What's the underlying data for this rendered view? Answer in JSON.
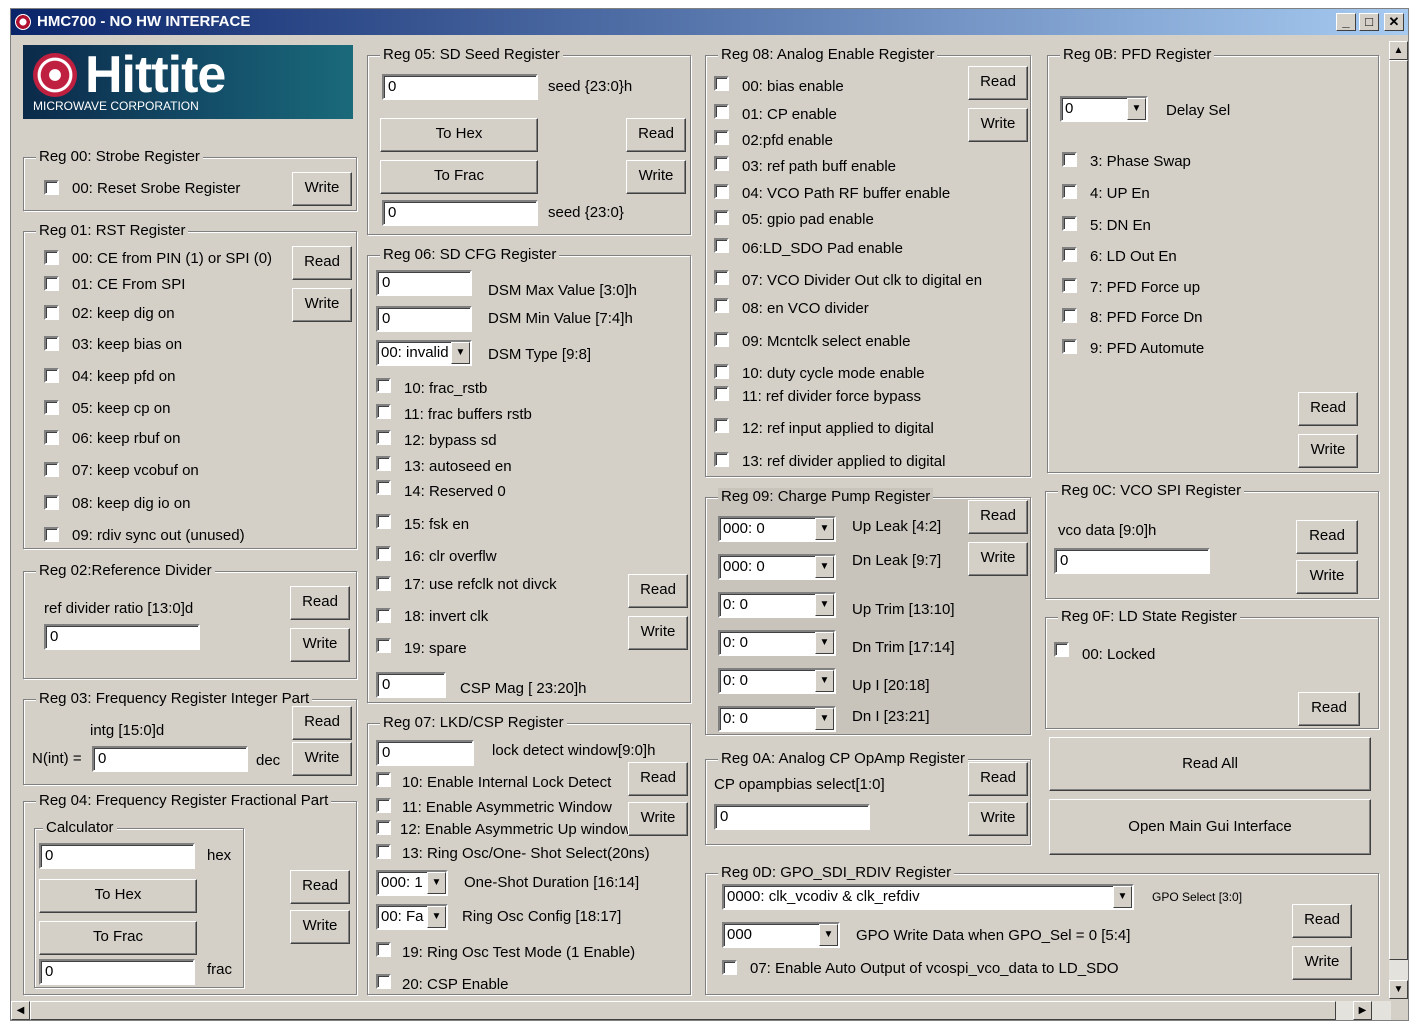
{
  "window": {
    "title": "HMC700 - NO HW INTERFACE"
  },
  "logo": {
    "name": "Hittite",
    "sub": "MICROWAVE CORPORATION"
  },
  "buttons": {
    "read": "Read",
    "write": "Write",
    "to_hex": "To Hex",
    "to_frac": "To Frac",
    "read_all": "Read All",
    "open_main": "Open Main Gui  Interface"
  },
  "reg00": {
    "title": "Reg 00: Strobe Register",
    "items": [
      "00: Reset Srobe Register"
    ]
  },
  "reg01": {
    "title": "Reg 01: RST Register",
    "items": [
      "00: CE from PIN (1) or SPI (0)",
      "01: CE From SPI",
      "02: keep dig on",
      "03: keep bias on",
      "04: keep pfd on",
      "05: keep cp on",
      "06: keep rbuf on",
      "07: keep vcobuf on",
      "08: keep dig io on",
      "09: rdiv sync out (unused)"
    ]
  },
  "reg02": {
    "title": "Reg 02:Reference Divider",
    "label": "ref divider ratio [13:0]d",
    "value": "0"
  },
  "reg03": {
    "title": "Reg 03: Frequency Register  Integer Part",
    "label": "intg [15:0]d",
    "nint": "N(int) =",
    "value": "0",
    "unit": "dec"
  },
  "reg04": {
    "title": "Reg 04: Frequency Register Fractional Part",
    "calc": "Calculator",
    "hex_value": "0",
    "hex_label": "hex",
    "frac_value": "0",
    "frac_label": "frac"
  },
  "reg05": {
    "title": "Reg 05: SD Seed Register",
    "seed_hex": "0",
    "seed_hex_label": "seed {23:0}h",
    "seed": "0",
    "seed_label": "seed {23:0}"
  },
  "reg06": {
    "title": "Reg 06: SD CFG Register",
    "max_value": "0",
    "max_label": "DSM Max Value [3:0]h",
    "min_value": "0",
    "min_label": "DSM Min Value [7:4]h",
    "type_value": "00: invalid",
    "type_label": "DSM Type [9:8]",
    "items": [
      "10: frac_rstb",
      "11: frac buffers rstb",
      "12: bypass sd",
      "13: autoseed en",
      "14: Reserved 0",
      "15: fsk en",
      "16: clr overflw",
      "17: use refclk not divck",
      "18: invert clk",
      "19: spare"
    ],
    "csp_value": "0",
    "csp_label": "CSP Mag [ 23:20]h"
  },
  "reg07": {
    "title": "Reg 07: LKD/CSP Register",
    "lock_value": "0",
    "lock_label": "lock detect window[9:0]h",
    "items": [
      "10: Enable Internal Lock Detect",
      "11: Enable Asymmetric Window",
      "12: Enable Asymmetric Up window",
      "13: Ring Osc/One- Shot Select(20ns)"
    ],
    "oneshot_value": "000: 1",
    "oneshot_label": "One-Shot  Duration [16:14]",
    "ring_value": "00: Fa",
    "ring_label": "Ring Osc Config [18:17]",
    "items2": [
      "19:  Ring Osc Test Mode (1 Enable)",
      "20: CSP Enable"
    ]
  },
  "reg08": {
    "title": "Reg 08: Analog Enable Register",
    "items": [
      "00: bias enable",
      "01: CP enable",
      "02:pfd enable",
      "03: ref path  buff enable",
      "04: VCO Path RF buffer enable",
      "05: gpio pad enable",
      "06:LD_SDO Pad enable",
      "07: VCO Divider Out clk to digital en",
      "08: en VCO divider",
      "09: Mcntclk select enable",
      "10: duty cycle mode enable",
      "11: ref divider force bypass",
      "12: ref input applied to digital",
      "13: ref divider applied to digital"
    ]
  },
  "reg09": {
    "title": "Reg 09: Charge Pump Register",
    "rows": [
      {
        "value": "000:  0",
        "label": "Up Leak [4:2]"
      },
      {
        "value": "000:  0",
        "label": "Dn Leak [9:7]"
      },
      {
        "value": "0: 0",
        "label": "Up Trim [13:10]"
      },
      {
        "value": "0: 0",
        "label": "Dn Trim [17:14]"
      },
      {
        "value": "0:  0",
        "label": "Up I [20:18]"
      },
      {
        "value": "0:  0",
        "label": "Dn I  [23:21]"
      }
    ]
  },
  "reg0a": {
    "title": "Reg 0A: Analog CP OpAmp Register",
    "label": "CP opampbias select[1:0]",
    "value": "0"
  },
  "reg0b": {
    "title": "Reg 0B: PFD Register",
    "delay_value": "0",
    "delay_label": "Delay Sel",
    "items": [
      "3: Phase Swap",
      "4: UP En",
      "5: DN En",
      "6: LD Out En",
      "7: PFD Force up",
      "8: PFD Force Dn",
      "9: PFD Automute"
    ]
  },
  "reg0c": {
    "title": "Reg 0C: VCO SPI Register",
    "label": "vco data [9:0]h",
    "value": "0"
  },
  "reg0d": {
    "title": "Reg 0D: GPO_SDI_RDIV Register",
    "gpo_value": "0000: clk_vcodiv & clk_refdiv",
    "gpo_label": "GPO Select [3:0]",
    "write_value": "000",
    "write_label": "GPO Write Data when GPO_Sel = 0 [5:4]",
    "item": "07: Enable Auto Output of vcospi_vco_data to LD_SDO"
  },
  "reg0f": {
    "title": "Reg 0F: LD State Register",
    "item": "00: Locked"
  }
}
